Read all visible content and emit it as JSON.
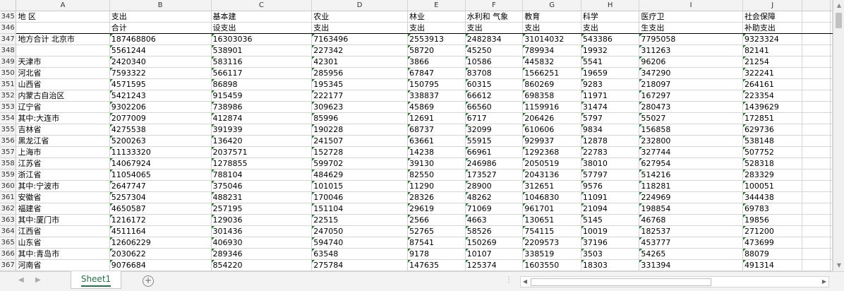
{
  "columns": [
    "A",
    "B",
    "C",
    "D",
    "E",
    "F",
    "G",
    "H",
    "I",
    "J"
  ],
  "header_rows": [
    {
      "num": "345",
      "cells": [
        "地  区",
        "支出",
        "基本建",
        "农业",
        "林业",
        "水利和  气象",
        "教育",
        "科学",
        "医疗卫",
        "社会保障"
      ]
    },
    {
      "num": "346",
      "cells": [
        "",
        "合计",
        "设支出",
        "支出",
        "支出",
        "支出",
        "支出",
        "支出",
        "生支出",
        "补助支出"
      ]
    }
  ],
  "rows": [
    {
      "num": "347",
      "cells": [
        "地方合计  北京市",
        "187468806",
        "16303036",
        "7163496",
        "2553913",
        "2482834",
        "31014032",
        "543386",
        "7795058",
        "9323324"
      ]
    },
    {
      "num": "348",
      "cells": [
        "",
        "5561244",
        "538901",
        "227342",
        "58720",
        "45250",
        "789934",
        "19932",
        "311263",
        "82141"
      ]
    },
    {
      "num": "349",
      "cells": [
        "天津市",
        "2420340",
        "583116",
        "42301",
        "3866",
        "10586",
        "445832",
        "5541",
        "96206",
        "21254"
      ]
    },
    {
      "num": "350",
      "cells": [
        "河北省",
        "7593322",
        "566117",
        "285956",
        "67847",
        "83708",
        "1566251",
        "19659",
        "347290",
        "322241"
      ]
    },
    {
      "num": "351",
      "cells": [
        "山西省",
        "4571595",
        "86898",
        "195345",
        "150795",
        "60315",
        "860269",
        "9283",
        "218097",
        "264161"
      ]
    },
    {
      "num": "352",
      "cells": [
        "内蒙古自治区",
        "5421243",
        "915459",
        "222177",
        "338837",
        "66612",
        "698358",
        "11971",
        "167297",
        "223354"
      ]
    },
    {
      "num": "353",
      "cells": [
        "辽宁省",
        "9302206",
        "738986",
        "309623",
        "45869",
        "66560",
        "1159916",
        "31474",
        "280473",
        "1439629"
      ]
    },
    {
      "num": "354",
      "cells": [
        "其中:大连市",
        "2077009",
        "412874",
        "85996",
        "12691",
        "6717",
        "206426",
        "5797",
        "55027",
        "172851"
      ]
    },
    {
      "num": "355",
      "cells": [
        "吉林省",
        "4275538",
        "391939",
        "190228",
        "68737",
        "32099",
        "610606",
        "9834",
        "156858",
        "629736"
      ]
    },
    {
      "num": "356",
      "cells": [
        "黑龙江省",
        "5200263",
        "136420",
        "241507",
        "63661",
        "55915",
        "929937",
        "12878",
        "232800",
        "538148"
      ]
    },
    {
      "num": "357",
      "cells": [
        "上海市",
        "11133320",
        "2037571",
        "152728",
        "14238",
        "66961",
        "1292368",
        "22783",
        "327744",
        "507752"
      ]
    },
    {
      "num": "358",
      "cells": [
        "江苏省",
        "14067924",
        "1278855",
        "599702",
        "39130",
        "246986",
        "2050519",
        "38010",
        "627954",
        "528318"
      ]
    },
    {
      "num": "359",
      "cells": [
        "浙江省",
        "11054065",
        "788104",
        "484629",
        "82550",
        "173527",
        "2043136",
        "57797",
        "514216",
        "283329"
      ]
    },
    {
      "num": "360",
      "cells": [
        "其中:宁波市",
        "2647747",
        "375046",
        "101015",
        "11290",
        "28900",
        "312651",
        "9576",
        "118281",
        "100051"
      ]
    },
    {
      "num": "361",
      "cells": [
        "安徽省",
        "5257304",
        "488231",
        "170046",
        "28326",
        "48262",
        "1046830",
        "11091",
        "224969",
        "344438"
      ]
    },
    {
      "num": "362",
      "cells": [
        "福建省",
        "4650587",
        "257195",
        "151104",
        "29619",
        "71069",
        "961701",
        "21094",
        "198854",
        "69783"
      ]
    },
    {
      "num": "363",
      "cells": [
        "其中:厦门市",
        "1216172",
        "129036",
        "22515",
        "2566",
        "4663",
        "130651",
        "5145",
        "46768",
        "19856"
      ]
    },
    {
      "num": "364",
      "cells": [
        "江西省",
        "4511164",
        "301436",
        "247050",
        "52765",
        "58526",
        "754115",
        "10019",
        "182537",
        "271200"
      ]
    },
    {
      "num": "365",
      "cells": [
        "山东省",
        "12606229",
        "406930",
        "594740",
        "87541",
        "150269",
        "2209573",
        "37196",
        "453777",
        "473699"
      ]
    },
    {
      "num": "366",
      "cells": [
        "其中:青岛市",
        "2030622",
        "289346",
        "63548",
        "9178",
        "10107",
        "338519",
        "3503",
        "54265",
        "88079"
      ]
    },
    {
      "num": "367",
      "cells": [
        "河南省",
        "9076684",
        "854220",
        "275784",
        "147635",
        "125374",
        "1603550",
        "18303",
        "331394",
        "491314"
      ]
    }
  ],
  "sheet_tab": "Sheet1",
  "icons": {
    "prev": "prev-sheet-icon",
    "next": "next-sheet-icon",
    "add": "add-sheet-icon"
  }
}
